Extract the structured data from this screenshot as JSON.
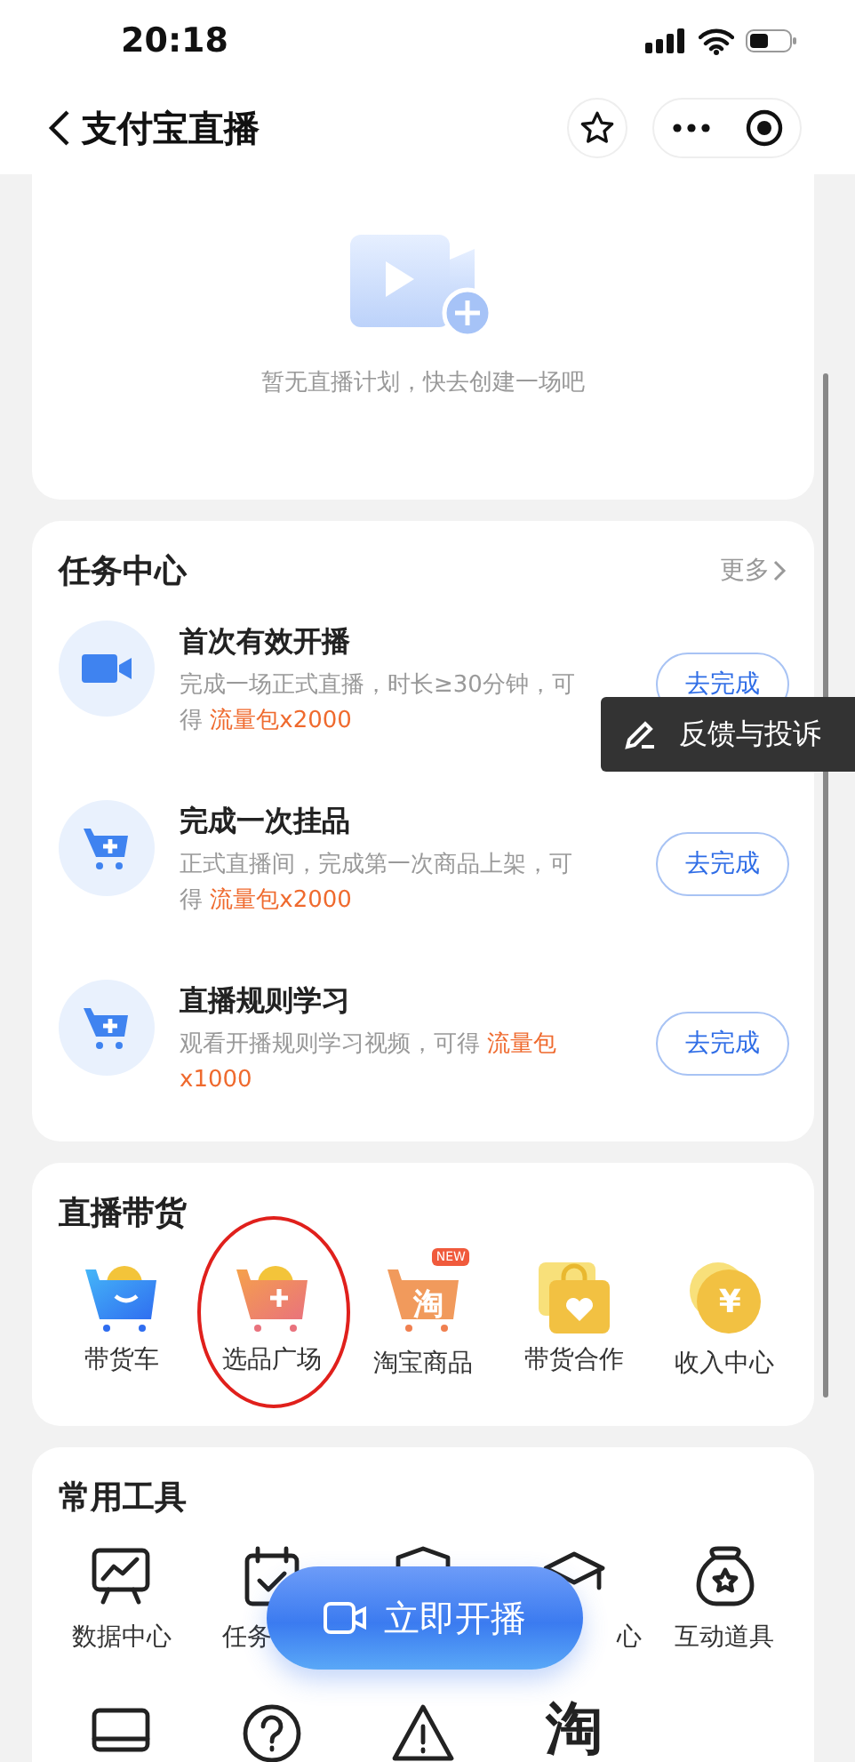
{
  "status_bar": {
    "time": "20:18"
  },
  "nav": {
    "title": "支付宝直播"
  },
  "plan_card": {
    "empty_text": "暂无直播计划，快去创建一场吧"
  },
  "task_center": {
    "title": "任务中心",
    "more": "更多",
    "tasks": [
      {
        "kind": "video",
        "title": "首次有效开播",
        "desc": "完成一场正式直播，时长≥30分钟，可得",
        "reward": "流量包x2000",
        "button": "去完成"
      },
      {
        "kind": "cart",
        "title": "完成一次挂品",
        "desc": "正式直播间，完成第一次商品上架，可得",
        "reward": "流量包x2000",
        "button": "去完成"
      },
      {
        "kind": "cart",
        "title": "直播规则学习",
        "desc": "观看开播规则学习视频，可得",
        "reward": "流量包x1000",
        "button": "去完成"
      }
    ]
  },
  "selling": {
    "title": "直播带货",
    "items": [
      {
        "kind": "cart-smile",
        "label": "带货车"
      },
      {
        "kind": "cart-plus",
        "label": "选品广场",
        "circled": true
      },
      {
        "kind": "cart-tao",
        "glyph": "淘",
        "badge": "NEW",
        "label": "淘宝商品"
      },
      {
        "kind": "bag-heart",
        "label": "带货合作"
      },
      {
        "kind": "coin",
        "glyph": "¥",
        "label": "收入中心"
      }
    ]
  },
  "tools": {
    "title": "常用工具",
    "items": [
      {
        "kind": "chart",
        "label": "数据中心"
      },
      {
        "kind": "calendar",
        "label": "任务",
        "clipped_end": true
      },
      {
        "kind": "shield"
      },
      {
        "kind": "cap",
        "label": "心",
        "clipped_start": true
      },
      {
        "kind": "bag-star",
        "label": "互动道具"
      },
      {
        "kind": "laptop"
      },
      {
        "kind": "question"
      },
      {
        "kind": "warning"
      },
      {
        "kind": "tao",
        "glyph": "淘"
      }
    ]
  },
  "live_button": {
    "label": "立即开播"
  },
  "feedback": {
    "label": "反馈与投诉"
  }
}
